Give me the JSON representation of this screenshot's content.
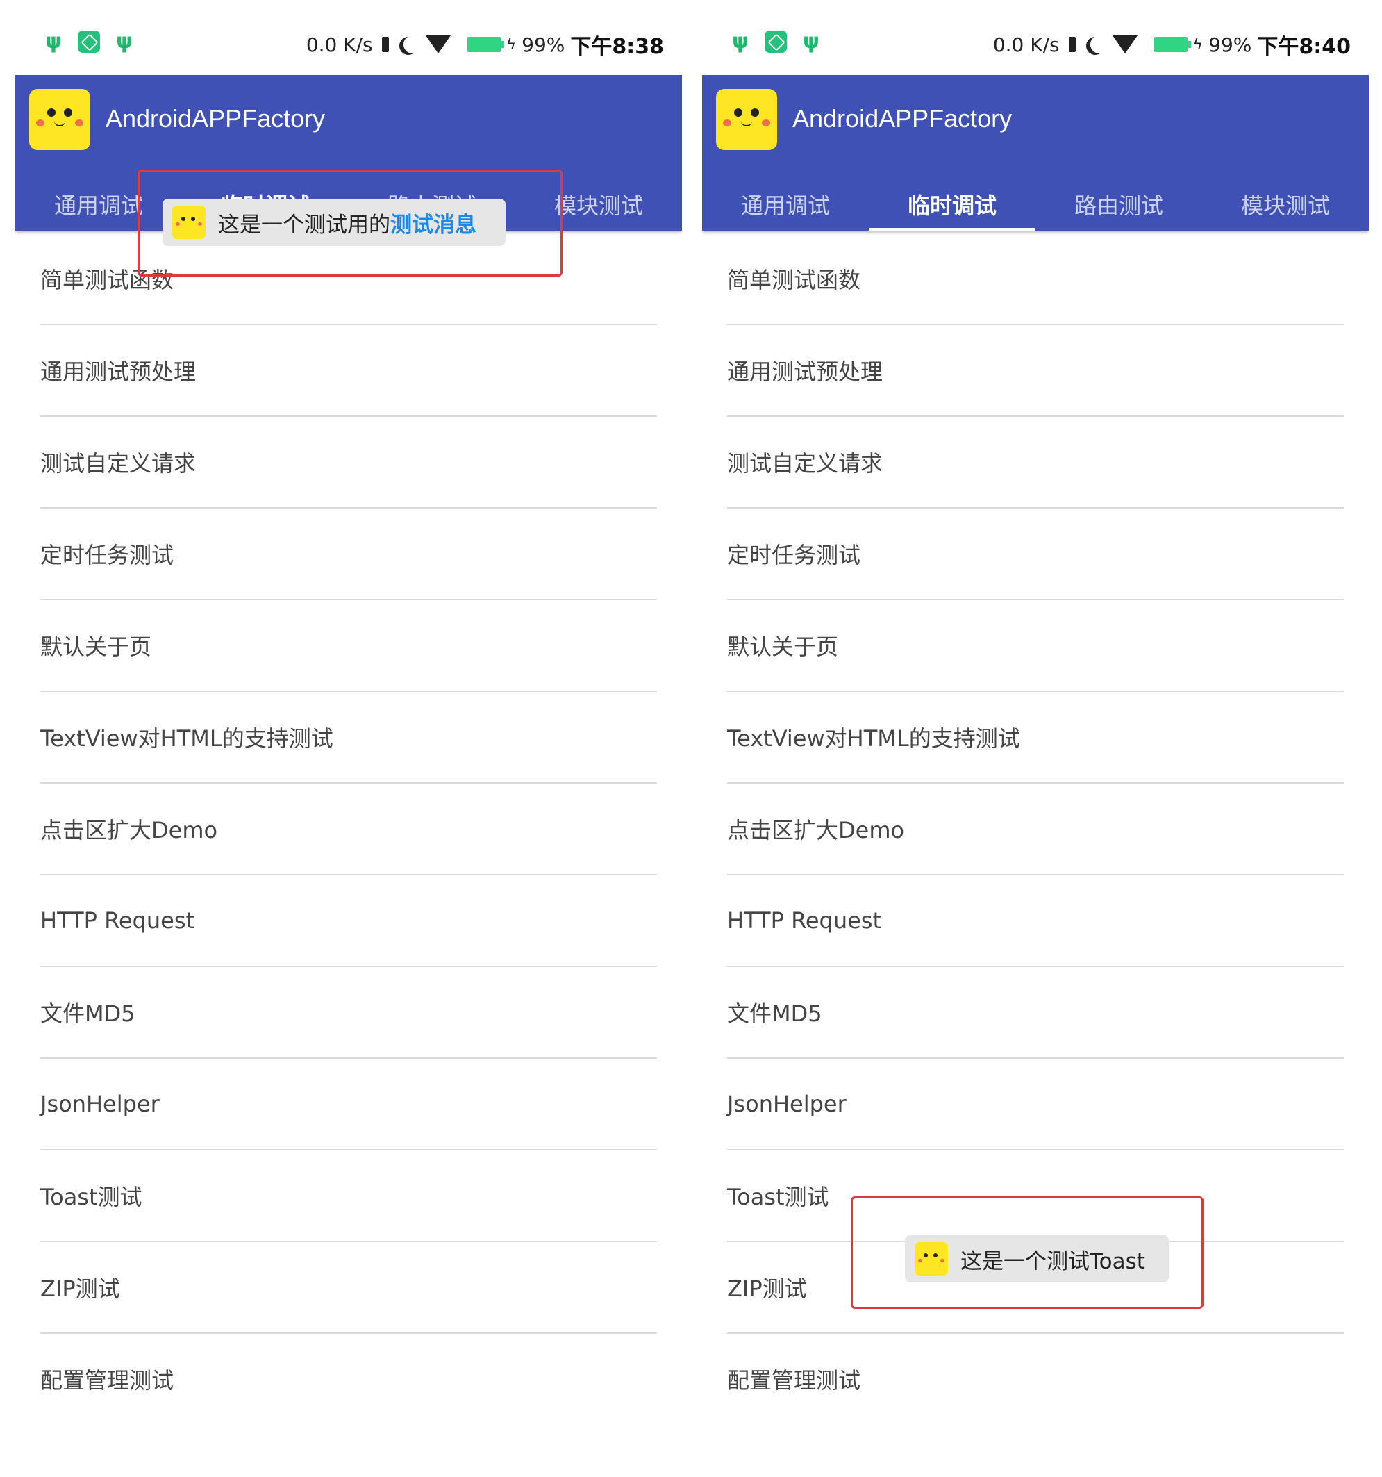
{
  "left_screen": {
    "status": {
      "speed": "0.0 K/s",
      "battery": "99%",
      "time": "下午8:38"
    },
    "app_title": "AndroidAPPFactory",
    "tabs": [
      "通用调试",
      "临时调试",
      "路由测试",
      "模块测试"
    ],
    "active_tab": 1,
    "toast": {
      "text": "这是一个测试用的",
      "highlight": "测试消息"
    },
    "items": [
      "简单测试函数",
      "通用测试预处理",
      "测试自定义请求",
      "定时任务测试",
      "默认关于页",
      "TextView对HTML的支持测试",
      "点击区扩大Demo",
      "HTTP Request",
      "文件MD5",
      "JsonHelper",
      "Toast测试",
      "ZIP测试",
      "配置管理测试"
    ]
  },
  "right_screen": {
    "status": {
      "speed": "0.0 K/s",
      "battery": "99%",
      "time": "下午8:40"
    },
    "app_title": "AndroidAPPFactory",
    "tabs": [
      "通用调试",
      "临时调试",
      "路由测试",
      "模块测试"
    ],
    "active_tab": 1,
    "toast": {
      "text": "这是一个测试Toast"
    },
    "items": [
      "简单测试函数",
      "通用测试预处理",
      "测试自定义请求",
      "定时任务测试",
      "默认关于页",
      "TextView对HTML的支持测试",
      "点击区扩大Demo",
      "HTTP Request",
      "文件MD5",
      "JsonHelper",
      "Toast测试",
      "ZIP测试",
      "配置管理测试"
    ]
  },
  "colors": {
    "appbar": "#3f51b5",
    "accent_highlight": "#1e88e5",
    "callout_border": "#e0383e",
    "battery": "#2fd583"
  },
  "icons": [
    "usb-icon",
    "app-store-icon",
    "vibrate-icon",
    "moon-icon",
    "wifi-icon",
    "battery-icon",
    "charging-icon",
    "app-logo-icon"
  ]
}
